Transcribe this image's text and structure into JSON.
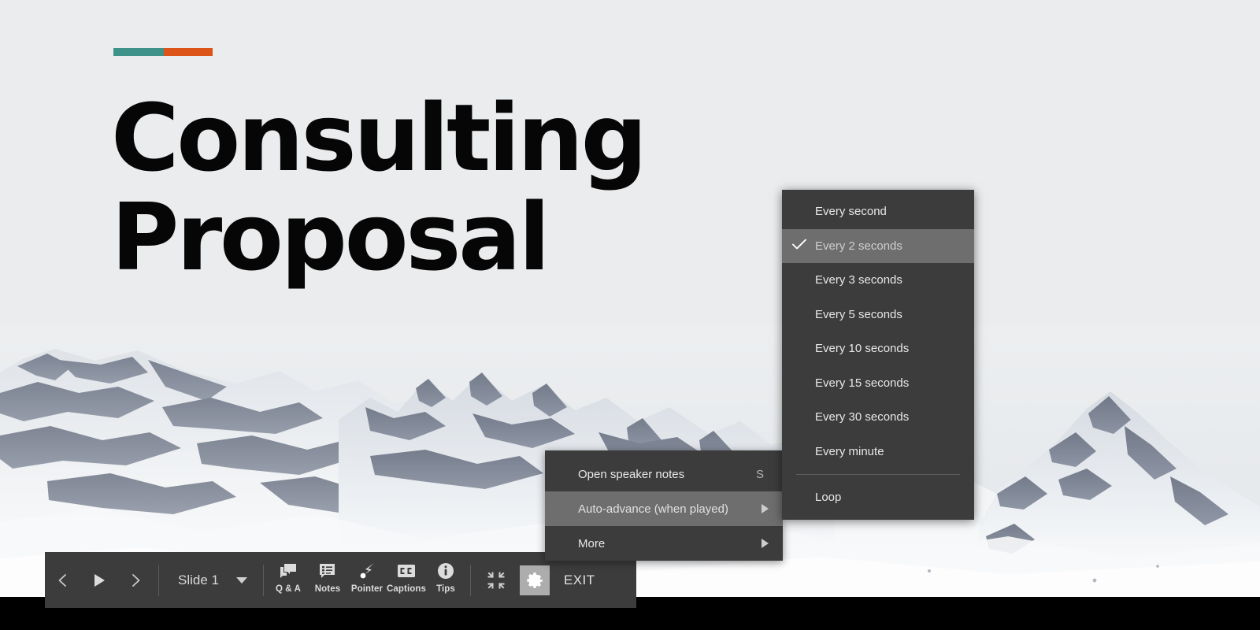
{
  "slide": {
    "title_line1": "Consulting",
    "title_line2": "Proposal",
    "accent_color_teal": "#3F9289",
    "accent_color_orange": "#DC5418",
    "background_color": "#EAECEE",
    "photo_alt": "snow-covered mountain range"
  },
  "toolbar": {
    "prev_icon": "chevron-left-icon",
    "play_icon": "play-icon",
    "next_icon": "chevron-right-icon",
    "slide_selector_label": "Slide 1",
    "slide_selector_caret": "chevron-down-icon",
    "tools": [
      {
        "label": "Q & A",
        "icon": "chat-bubbles-icon"
      },
      {
        "label": "Notes",
        "icon": "speaker-notes-icon"
      },
      {
        "label": "Pointer",
        "icon": "laser-pointer-icon"
      },
      {
        "label": "Captions",
        "icon": "closed-captions-icon"
      },
      {
        "label": "Tips",
        "icon": "info-circle-icon"
      }
    ],
    "fit_icon": "exit-fullscreen-icon",
    "settings_icon": "gear-icon",
    "exit_label": "EXIT",
    "background_color": "#3C3C3C",
    "settings_highlight_color": "#ADADAD"
  },
  "context_menu": {
    "items": [
      {
        "label": "Open speaker notes",
        "accel": "S",
        "arrow": false,
        "highlighted": false
      },
      {
        "label": "Auto-advance (when played)",
        "accel": "",
        "arrow": true,
        "highlighted": true
      },
      {
        "label": "More",
        "accel": "",
        "arrow": true,
        "highlighted": false
      }
    ],
    "background_color": "#3C3C3C",
    "highlight_color": "#6E6E6E"
  },
  "auto_advance_submenu": {
    "items": [
      {
        "label": "Every second",
        "checked": false
      },
      {
        "label": "Every 2 seconds",
        "checked": true
      },
      {
        "label": "Every 3 seconds",
        "checked": false
      },
      {
        "label": "Every 5 seconds",
        "checked": false
      },
      {
        "label": "Every 10 seconds",
        "checked": false
      },
      {
        "label": "Every 15 seconds",
        "checked": false
      },
      {
        "label": "Every 30 seconds",
        "checked": false
      },
      {
        "label": "Every minute",
        "checked": false
      }
    ],
    "loop_label": "Loop",
    "check_icon": "check-icon",
    "background_color": "#3C3C3C",
    "highlight_color": "#6E6E6E"
  }
}
